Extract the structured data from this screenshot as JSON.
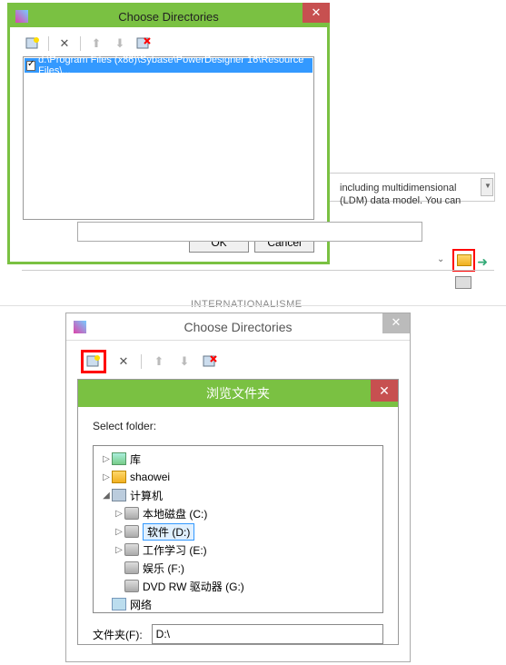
{
  "dialog1": {
    "title": "Choose Directories",
    "list_item": "d:\\Program Files (x86)\\Sybase\\PowerDesigner 16\\Resource Files\\...",
    "ok": "OK",
    "cancel": "Cancel"
  },
  "bg_text_line1": "including multidimensional",
  "bg_text_line2": "(LDM) data model. You can",
  "blur": "INTERNATIONALISME",
  "dialog2": {
    "title": "Choose Directories"
  },
  "browse": {
    "title": "浏览文件夹",
    "select_label": "Select folder:",
    "folder_label": "文件夹(F):",
    "folder_value": "D:\\",
    "tree": [
      {
        "label": "库",
        "exp": "▷",
        "icon": "ic-lib",
        "ind": "ind1"
      },
      {
        "label": "shaowei",
        "exp": "▷",
        "icon": "ic-user",
        "ind": "ind1"
      },
      {
        "label": "计算机",
        "exp": "◢",
        "icon": "ic-computer",
        "ind": "ind1"
      },
      {
        "label": "本地磁盘 (C:)",
        "exp": "▷",
        "icon": "ic-disk",
        "ind": "ind2"
      },
      {
        "label": "软件 (D:)",
        "exp": "▷",
        "icon": "ic-disk",
        "ind": "ind2",
        "selected": true
      },
      {
        "label": "工作学习 (E:)",
        "exp": "▷",
        "icon": "ic-disk",
        "ind": "ind2"
      },
      {
        "label": "娱乐 (F:)",
        "exp": "",
        "icon": "ic-disk",
        "ind": "ind2"
      },
      {
        "label": "DVD RW 驱动器 (G:)",
        "exp": "",
        "icon": "ic-disk",
        "ind": "ind2"
      },
      {
        "label": "网络",
        "exp": "",
        "icon": "ic-net",
        "ind": "ind1"
      }
    ]
  }
}
